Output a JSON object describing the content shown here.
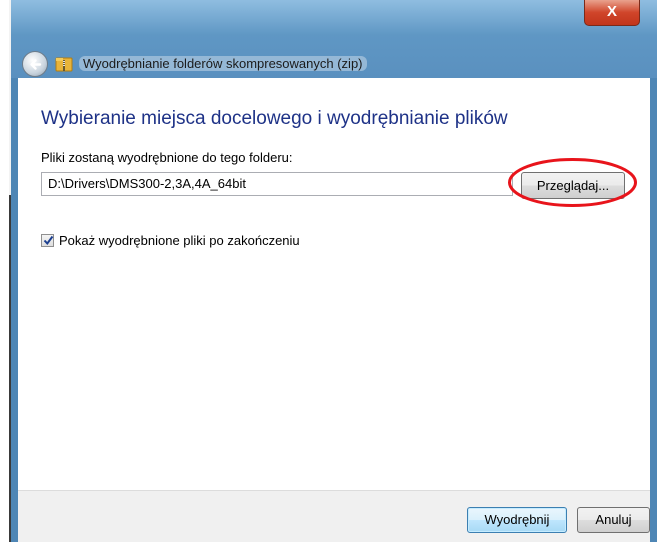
{
  "window": {
    "title": "Wyodrębnianie folderów skompresowanych (zip)",
    "close_label": "X"
  },
  "main": {
    "heading": "Wybieranie miejsca docelowego i wyodrębnianie plików",
    "path_label": "Pliki zostaną wyodrębnione do tego folderu:",
    "path_value": "D:\\Drivers\\DMS300-2,3A,4A_64bit",
    "browse_label": "Przeglądaj...",
    "show_files_checkbox": {
      "label": "Pokaż wyodrębnione pliki po zakończeniu",
      "checked": true
    }
  },
  "footer": {
    "extract_label": "Wyodrębnij",
    "cancel_label": "Anuluj"
  },
  "annotation": {
    "color": "#e8141b"
  },
  "icons": {
    "back": "back-arrow-icon",
    "zip": "zip-folder-icon",
    "check": "checkmark-icon"
  }
}
